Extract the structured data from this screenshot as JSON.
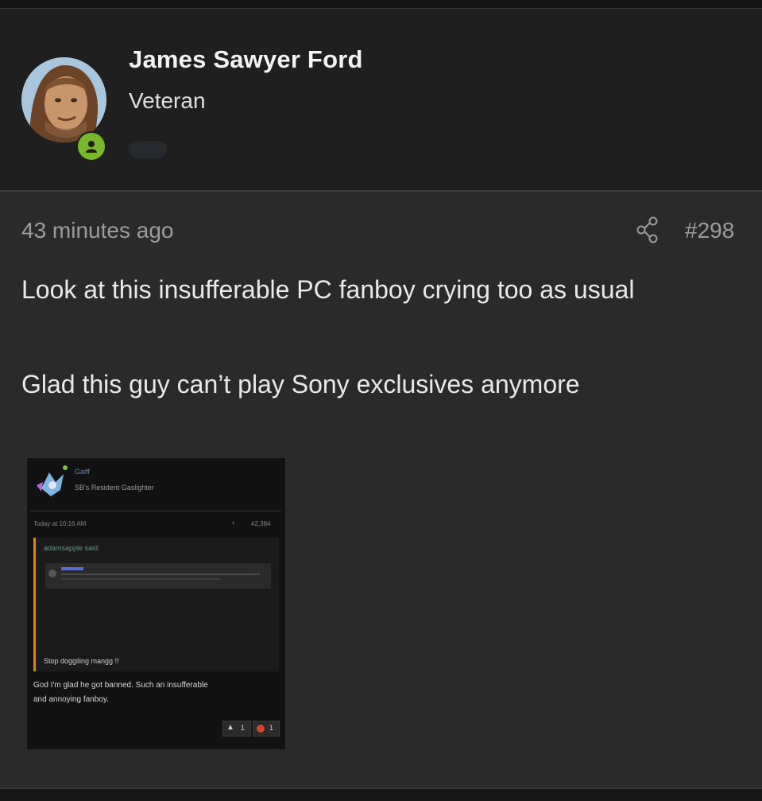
{
  "post": {
    "author": {
      "name": "James Sawyer Ford",
      "title": "Veteran",
      "status": "online",
      "status_color": "#77b72a"
    },
    "time": "43 minutes ago",
    "number": "#298",
    "share_icon": "share-icon",
    "lines": [
      "Look at this insufferable PC fanboy crying too as usual",
      "Glad this guy can’t play Sony exclusives anymore"
    ],
    "attachment": {
      "author": "Gaiff",
      "author_title": "SB's Resident Gaslighter",
      "time": "Today at 10:16 AM",
      "number": "#2,384",
      "quote_author": "adamsapple said:",
      "quote_text": "Stop doggiling mangg !!",
      "body_line1": "God I'm glad he got banned. Such an insufferable",
      "body_line2": "and annoying fanboy.",
      "reaction_like": "1",
      "reaction_other": "1"
    }
  }
}
